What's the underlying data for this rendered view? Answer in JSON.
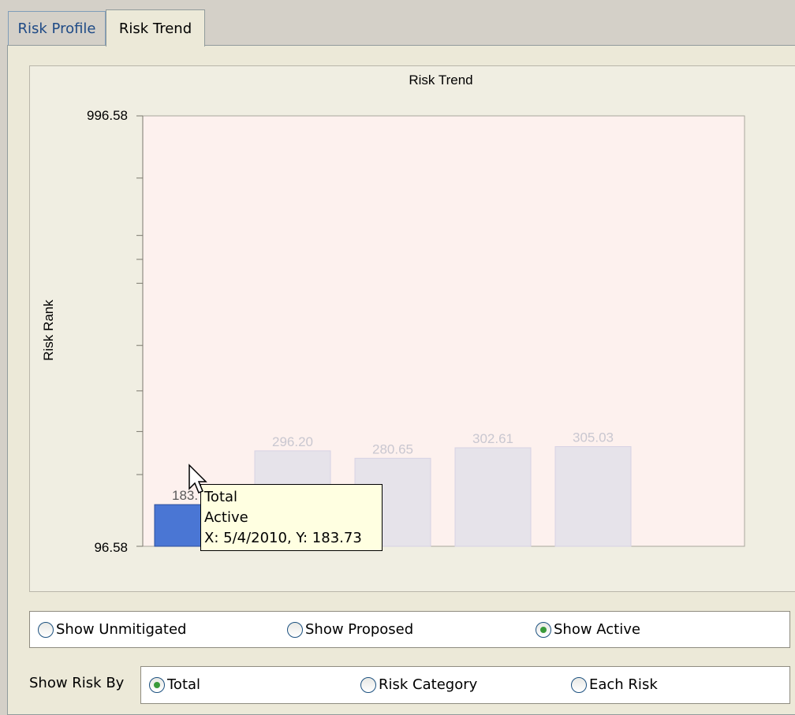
{
  "tabs": [
    {
      "label": "Risk Profile",
      "active": false
    },
    {
      "label": "Risk Trend",
      "active": true
    }
  ],
  "chart_data": {
    "type": "bar",
    "title": "Risk Trend",
    "ylabel": "Risk Rank",
    "xlabel": "",
    "ylim": [
      96.58,
      996.58
    ],
    "ytick_labels": [
      "996.58",
      "96.58"
    ],
    "values": [
      183.73,
      296.2,
      280.65,
      302.61,
      305.03
    ],
    "value_labels": [
      "183.73",
      "296.20",
      "280.65",
      "302.61",
      "305.03"
    ],
    "highlighted_index": 0,
    "colors": {
      "highlight": "#4a76d4",
      "faded": "#e6e3ea",
      "faded_stroke": "#d6d2e4",
      "plot_bg": "#fdf1ee",
      "faded_label": "#c9c7d0"
    }
  },
  "tooltip": {
    "line1": "Total",
    "line2": "Active",
    "line3": "X: 5/4/2010, Y: 183.73"
  },
  "view_options": [
    {
      "label": "Show Unmitigated",
      "checked": false
    },
    {
      "label": "Show Proposed",
      "checked": false
    },
    {
      "label": "Show Active",
      "checked": true
    }
  ],
  "show_risk_by": {
    "label": "Show Risk By",
    "options": [
      {
        "label": "Total",
        "checked": true
      },
      {
        "label": "Risk Category",
        "checked": false
      },
      {
        "label": "Each Risk",
        "checked": false
      }
    ]
  }
}
